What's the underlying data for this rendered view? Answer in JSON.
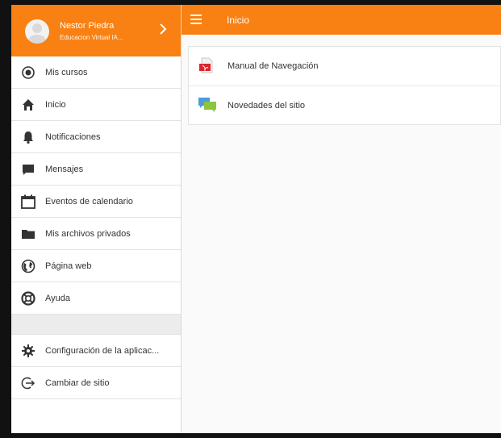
{
  "user": {
    "name": "Nestor Piedra",
    "site": "Educacion Virtual IA..."
  },
  "sidebar": {
    "items": [
      {
        "label": "Mis cursos",
        "icon": "radio-target-icon"
      },
      {
        "label": "Inicio",
        "icon": "home-icon"
      },
      {
        "label": "Notificaciones",
        "icon": "bell-icon"
      },
      {
        "label": "Mensajes",
        "icon": "chat-bubble-icon"
      },
      {
        "label": "Eventos de calendario",
        "icon": "calendar-icon"
      },
      {
        "label": "Mis archivos privados",
        "icon": "folder-icon"
      },
      {
        "label": "Página web",
        "icon": "globe-icon"
      },
      {
        "label": "Ayuda",
        "icon": "lifebuoy-icon"
      }
    ],
    "footer_items": [
      {
        "label": "Configuración de la aplicac...",
        "icon": "gear-icon"
      },
      {
        "label": "Cambiar de sitio",
        "icon": "exit-icon"
      }
    ]
  },
  "header": {
    "title": "Inicio"
  },
  "main": {
    "items": [
      {
        "label": "Manual de Navegación",
        "icon": "pdf-file-icon"
      },
      {
        "label": "Novedades del sitio",
        "icon": "forum-icon"
      }
    ]
  },
  "colors": {
    "accent": "#f98012"
  }
}
